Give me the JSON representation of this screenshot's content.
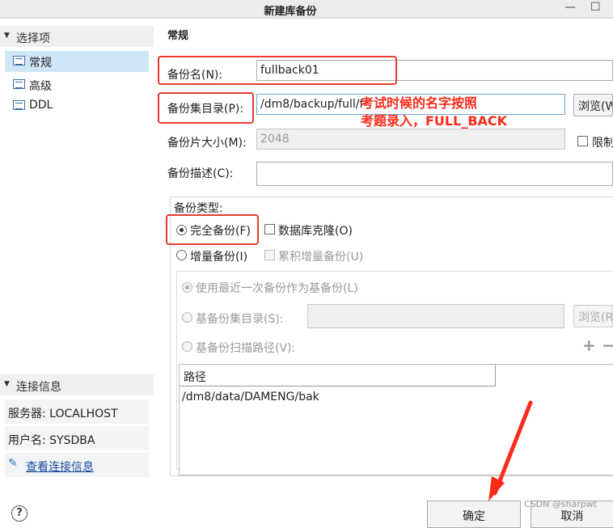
{
  "window": {
    "title": "新建库备份",
    "minimize": "—",
    "maximize": "☐"
  },
  "sidebar": {
    "options_header": "选择项",
    "items": [
      {
        "label": "常规",
        "selected": true
      },
      {
        "label": "高级",
        "selected": false
      },
      {
        "label": "DDL",
        "selected": false
      }
    ],
    "conn_header": "连接信息",
    "server": "服务器: LOCALHOST",
    "user": "用户名: SYSDBA",
    "view_conn_link": "查看连接信息"
  },
  "main": {
    "section_title": "常规",
    "backup_name_label": "备份名(N):",
    "backup_name_value": "fullback01",
    "backup_dir_label": "备份集目录(P):",
    "backup_dir_value": "/dm8/backup/full/f",
    "browse_label": "浏览(W",
    "piece_size_label": "备份片大小(M):",
    "piece_size_value": "2048",
    "limit_label": "限制",
    "desc_label": "备份描述(C):",
    "desc_value": "",
    "type_label": "备份类型:",
    "full_backup_label": "完全备份(F)",
    "clone_label": "数据库克隆(O)",
    "incr_backup_label": "增量备份(I)",
    "cumulative_label": "累积增量备份(U)",
    "use_recent_label": "使用最近一次备份作为基备份(L)",
    "base_dir_label": "基备份集目录(S):",
    "base_dir_value": "",
    "browse2_label": "浏览(R",
    "scan_path_label": "基备份扫描路径(V):",
    "add_label": "+",
    "remove_label": "−",
    "path_column": "路径",
    "path_rows": [
      "/dm8/data/DAMENG/bak"
    ]
  },
  "annotation": {
    "line1": "考试时候的名字按照",
    "line2": "考题录入，FULL_BACK",
    "color": "#ff2a1a"
  },
  "footer": {
    "ok_label": "确定",
    "cancel_label": "取消",
    "help_icon": "?"
  },
  "watermark": "CSDN @sharpwt"
}
